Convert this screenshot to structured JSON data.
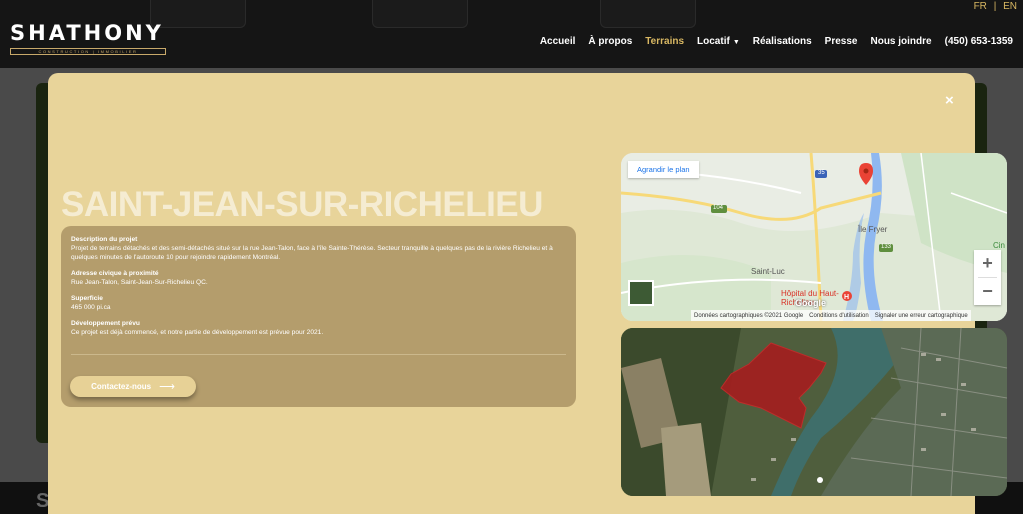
{
  "header": {
    "logo_title": "SHATHONY",
    "logo_subtitle": "CONSTRUCTION | IMMOBILIER",
    "languages": [
      "FR",
      "EN"
    ],
    "nav": [
      {
        "label": "Accueil"
      },
      {
        "label": "À propos"
      },
      {
        "label": "Terrains"
      },
      {
        "label": "Locatif"
      },
      {
        "label": "Réalisations"
      },
      {
        "label": "Presse"
      },
      {
        "label": "Nous joindre"
      },
      {
        "label": "(450) 653-1359"
      }
    ]
  },
  "colors": {
    "accent": "#d9b863",
    "modal_bg": "#e8d49a",
    "panel_bg": "#b49d6c"
  },
  "background_page": {
    "footer_text": "S"
  },
  "modal": {
    "close_icon": "×",
    "title": "SAINT-JEAN-SUR-RICHELIEU",
    "sections": [
      {
        "label": "Description du projet",
        "text": "Projet de terrains détachés et des semi-détachés situé sur la rue Jean-Talon, face à l'île Sainte-Thérèse. Secteur tranquille à quelques pas de la rivière Richelieu et à quelques minutes de l'autoroute 10 pour rejoindre rapidement Montréal."
      },
      {
        "label": "Adresse civique à proximité",
        "text": "Rue Jean-Talon, Saint-Jean-Sur-Richelieu QC."
      },
      {
        "label": "Superficie",
        "text": "465 000 pi.ca"
      },
      {
        "label": "Développement prévu",
        "text": "Ce projet est déjà commencé, et notre partie de développement est prévue pour 2021."
      }
    ],
    "contact_button": "Contactez-nous",
    "map": {
      "enlarge_button": "Agrandir le plan",
      "labels": {
        "ile": "Île Fryer",
        "saint_luc": "Saint-Luc",
        "cin": "Cin",
        "route_104": "104",
        "route_35": "35",
        "route_133": "133",
        "hospital": "Hôpital du Haut-Richelieu",
        "google": "Google"
      },
      "footer": [
        "Données cartographiques ©2021 Google",
        "Conditions d'utilisation",
        "Signaler une erreur cartographique"
      ],
      "zoom_in": "+",
      "zoom_out": "−"
    }
  }
}
